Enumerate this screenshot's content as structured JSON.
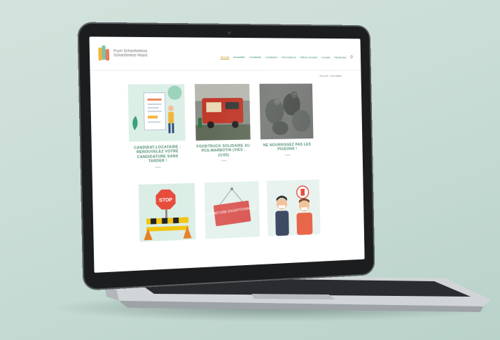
{
  "site": {
    "logo_line1": "Foyer Schaerbeekois",
    "logo_line2": "Schaerbeekse Haard"
  },
  "nav": {
    "items": [
      "Accueil",
      "Actualités",
      "Candidats",
      "Locataires",
      "Informations",
      "Offres d'emploi",
      "Contact",
      "Patrimoine"
    ],
    "search_icon": "magnifier",
    "active_index": 0
  },
  "breadcrumb": "Accueil > Actualités",
  "cards": [
    {
      "title": "CANDIDAT-LOCATAIRE : RENOUVELEZ VOTRE CANDIDATURE SANS TARDER !",
      "image": "document-illustration"
    },
    {
      "title": "FOODTRUCK SOLIDAIRE AU PCS-MARBOTIN (VIES - 21/05)",
      "image": "red-food-truck-photo"
    },
    {
      "title": "NE NOURRISSEZ PAS LES PIGEONS !",
      "image": "pigeons-photo"
    },
    {
      "title": "",
      "image": "stop-road-barrier-illustration"
    },
    {
      "title": "",
      "image": "fermeture-exceptionnelle-sign"
    },
    {
      "title": "",
      "image": "masked-people-vaccination-illustration"
    }
  ],
  "sign_text": "FERMETURE EXCEPTIONNELLE",
  "stop_text": "STOP",
  "colors": {
    "background": "#c9ddd6",
    "title_green": "#4c8c6e",
    "nav_green": "#3b8a63",
    "nav_active": "#c59a2a",
    "laptop_bezel": "#1c1d1f",
    "laptop_body": "#c5c8cb"
  }
}
